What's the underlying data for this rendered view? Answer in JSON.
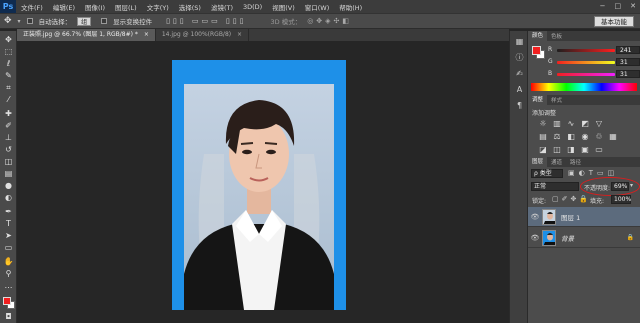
{
  "app": {
    "logo": "Ps"
  },
  "menu": [
    "文件(F)",
    "编辑(E)",
    "图像(I)",
    "图层(L)",
    "文字(Y)",
    "选择(S)",
    "滤镜(T)",
    "3D(D)",
    "视图(V)",
    "窗口(W)",
    "帮助(H)"
  ],
  "window_controls": [
    "−",
    "□",
    "✕"
  ],
  "options": {
    "auto_select_label": "自动选择：",
    "auto_select_value": "组",
    "show_transform_label": "显示变换控件",
    "mode_3d_label": "3D 模式：",
    "workspace": "基本功能"
  },
  "tabs": [
    {
      "label": "正装照.jpg @ 66.7% (图层 1, RGB/8#) *",
      "close": "×"
    },
    {
      "label": "14.jpg @ 100%(RGB/8)",
      "close": "×"
    }
  ],
  "color_panel": {
    "tabs": [
      "颜色",
      "色板"
    ],
    "r_label": "R",
    "r_value": "241",
    "g_label": "G",
    "g_value": "31",
    "b_label": "B",
    "b_value": "31",
    "foreground_color": "#f11f1f"
  },
  "adjustments_panel": {
    "tabs": [
      "调整",
      "样式"
    ],
    "add_label": "添加调整"
  },
  "layers_panel": {
    "tabs": [
      "图层",
      "通道",
      "路径"
    ],
    "filter_label": "ρ 类型",
    "blend_mode": "正常",
    "opacity_label": "不透明度:",
    "opacity_value": "69%",
    "lock_label": "锁定:",
    "fill_label": "填充:",
    "fill_value": "100%",
    "layers": [
      {
        "name": "图层 1",
        "selected": true
      },
      {
        "name": "背景",
        "selected": false
      }
    ]
  },
  "colors": {
    "canvas_background": "#1e90e8",
    "foreground": "#f11f1f",
    "annotation": "#d81e1e"
  }
}
